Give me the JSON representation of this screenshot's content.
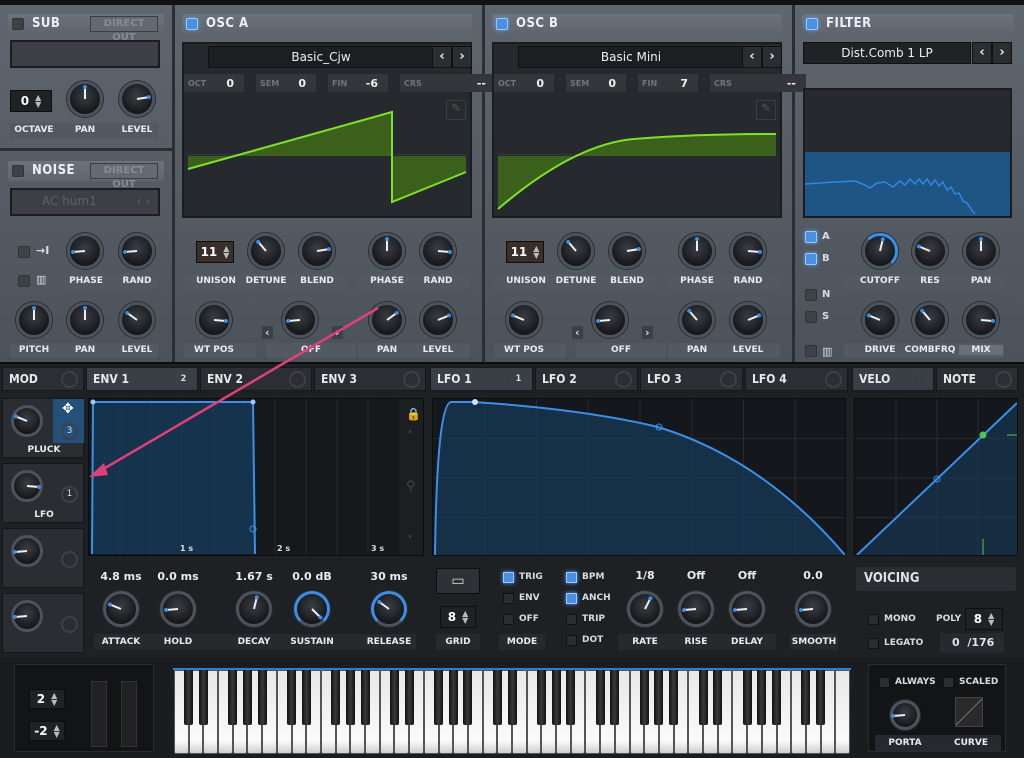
{
  "sub": {
    "title": "SUB",
    "direct_out": "DIRECT OUT",
    "octave": "0",
    "labels": [
      "OCTAVE",
      "PAN",
      "LEVEL"
    ],
    "knobs": {
      "pan": 0.5,
      "level": 0.8
    },
    "enabled": false
  },
  "noise": {
    "title": "NOISE",
    "direct_out": "DIRECT OUT",
    "sample": "AC hum1",
    "labels": [
      "PHASE",
      "RAND",
      "PITCH",
      "PAN",
      "LEVEL"
    ],
    "knobs": {
      "phase": 0.15,
      "rand": 0.15,
      "pitch": 0.5,
      "pan": 0.5,
      "level": 0.3
    },
    "enabled": false
  },
  "osc_a": {
    "title": "OSC  A",
    "enabled": true,
    "wavetable": "Basic_Cjw",
    "tuning": [
      {
        "label": "OCT",
        "value": "0"
      },
      {
        "label": "SEM",
        "value": "0"
      },
      {
        "label": "FIN",
        "value": "-6"
      },
      {
        "label": "CRS",
        "value": "--"
      }
    ],
    "unison": "11",
    "warp_mode": "OFF",
    "labels": {
      "unison": "UNISON",
      "detune": "DETUNE",
      "blend": "BLEND",
      "phase": "PHASE",
      "rand": "RAND",
      "wtpos": "WT POS",
      "pan": "PAN",
      "level": "LEVEL"
    },
    "knobs": {
      "detune": 0.35,
      "blend": 0.8,
      "phase": 0.5,
      "rand": 0.85,
      "wtpos": 0.85,
      "warp": 0.15,
      "pan": 0.7,
      "level": 0.75
    }
  },
  "osc_b": {
    "title": "OSC  B",
    "enabled": true,
    "wavetable": "Basic Mini",
    "tuning": [
      {
        "label": "OCT",
        "value": "0"
      },
      {
        "label": "SEM",
        "value": "0"
      },
      {
        "label": "FIN",
        "value": "7"
      },
      {
        "label": "CRS",
        "value": "--"
      }
    ],
    "unison": "11",
    "warp_mode": "OFF",
    "labels": {
      "unison": "UNISON",
      "detune": "DETUNE",
      "blend": "BLEND",
      "phase": "PHASE",
      "rand": "RAND",
      "wtpos": "WT POS",
      "pan": "PAN",
      "level": "LEVEL"
    },
    "knobs": {
      "detune": 0.35,
      "blend": 0.8,
      "phase": 0.5,
      "rand": 0.85,
      "wtpos": 0.25,
      "warp": 0.15,
      "pan": 0.35,
      "level": 0.75
    }
  },
  "filter": {
    "title": "FILTER",
    "enabled": true,
    "type": "Dist.Comb 1 LP",
    "routes": [
      {
        "label": "A",
        "on": true
      },
      {
        "label": "B",
        "on": true
      },
      {
        "label": "N",
        "on": false
      },
      {
        "label": "S",
        "on": false
      }
    ],
    "labels": {
      "cutoff": "CUTOFF",
      "res": "RES",
      "pan": "PAN",
      "drive": "DRIVE",
      "combfrq": "COMBFRQ",
      "mix": "MIX"
    },
    "knobs": {
      "cutoff": 0.55,
      "res": 0.25,
      "pan": 0.5,
      "drive": 0.25,
      "combfrq": 0.35,
      "mix": 0.85
    }
  },
  "mod": {
    "title": "MOD",
    "slots": [
      {
        "label": "PLUCK",
        "badge": "3",
        "knob": 0.25
      },
      {
        "label": "LFO",
        "badge": "1",
        "knob": 0.85
      },
      {
        "label": "",
        "badge": "",
        "knob": 0.15
      },
      {
        "label": "",
        "badge": "",
        "knob": 0.15
      }
    ]
  },
  "env": {
    "tabs": [
      {
        "label": "ENV 1",
        "badge": "2"
      },
      {
        "label": "ENV 2",
        "badge": ""
      },
      {
        "label": "ENV 3",
        "badge": ""
      }
    ],
    "time_marks": [
      "1 s",
      "2 s",
      "3 s"
    ],
    "params": [
      {
        "label": "ATTACK",
        "value": "4.8 ms",
        "knob": 0.25
      },
      {
        "label": "HOLD",
        "value": "0.0 ms",
        "knob": 0.15
      },
      {
        "label": "DECAY",
        "value": "1.67 s",
        "knob": 0.55
      },
      {
        "label": "SUSTAIN",
        "value": "0.0 dB",
        "knob": 1.0
      },
      {
        "label": "RELEASE",
        "value": "30 ms",
        "knob": 0.3
      }
    ]
  },
  "lfo": {
    "tabs": [
      {
        "label": "LFO 1",
        "badge": "1"
      },
      {
        "label": "LFO 2",
        "badge": ""
      },
      {
        "label": "LFO 3",
        "badge": ""
      },
      {
        "label": "LFO 4",
        "badge": ""
      }
    ],
    "grid": "8",
    "grid_label": "GRID",
    "mode_label": "MODE",
    "modes": [
      {
        "label": "TRIG",
        "on": true
      },
      {
        "label": "ENV",
        "on": false
      },
      {
        "label": "OFF",
        "on": false
      }
    ],
    "options": [
      {
        "label": "BPM",
        "on": true
      },
      {
        "label": "ANCH",
        "on": true
      },
      {
        "label": "TRIP",
        "on": false
      },
      {
        "label": "DOT",
        "on": false
      }
    ],
    "params": [
      {
        "label": "RATE",
        "value": "1/8",
        "knob": 0.6
      },
      {
        "label": "RISE",
        "value": "Off",
        "knob": 0.15
      },
      {
        "label": "DELAY",
        "value": "Off",
        "knob": 0.15
      },
      {
        "label": "SMOOTH",
        "value": "0.0",
        "knob": 0.15
      }
    ]
  },
  "velo": {
    "tabs": [
      {
        "label": "VELO"
      },
      {
        "label": "NOTE"
      }
    ]
  },
  "voicing": {
    "title": "VOICING",
    "mono": "MONO",
    "legato": "LEGATO",
    "poly_label": "POLY",
    "poly": "8",
    "voices": "0",
    "voices_max": "/176"
  },
  "keyboard": {
    "pitch_up": "2",
    "pitch_down": "-2",
    "always": "ALWAYS",
    "scaled": "SCALED",
    "porta": "PORTA",
    "curve": "CURVE",
    "porta_knob": 0.15
  },
  "colors": {
    "accent": "#3b8fe8",
    "wave": "#7fe02a",
    "annotation_arrow": "#e0407a"
  }
}
